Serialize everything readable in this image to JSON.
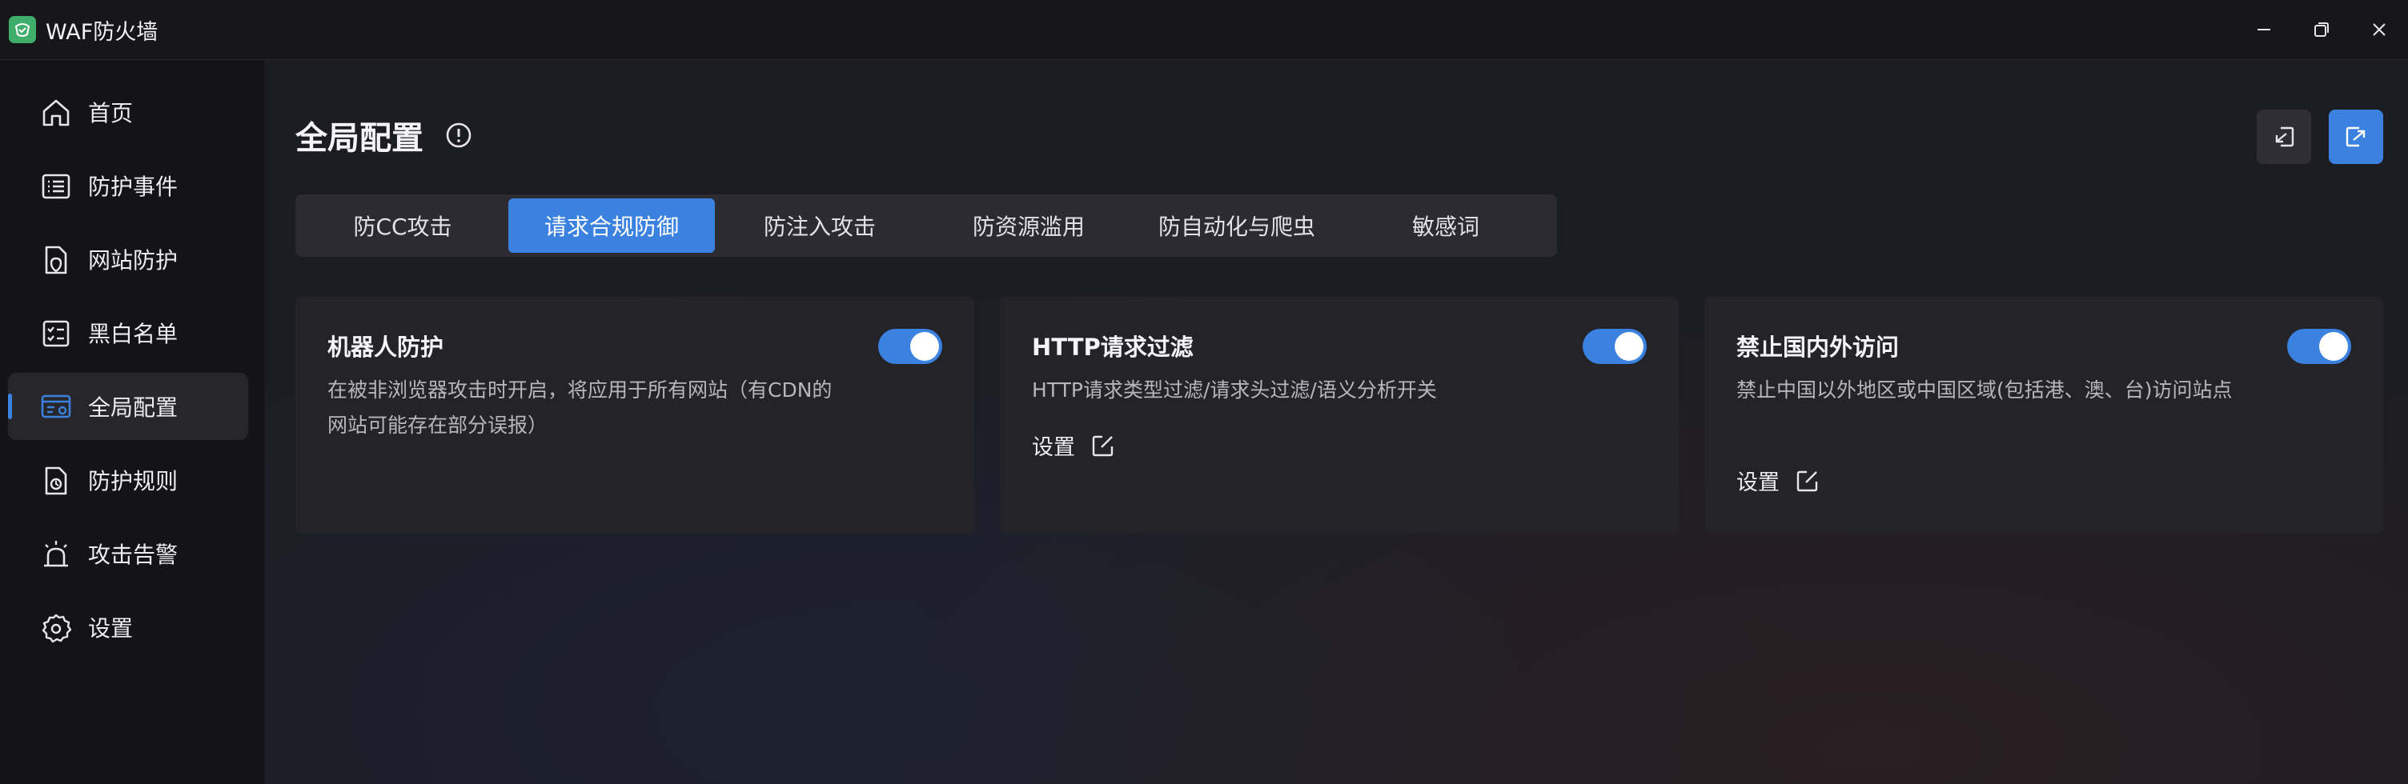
{
  "window": {
    "title": "WAF防火墙",
    "logo_text": "WAF"
  },
  "sidebar": {
    "items": [
      {
        "label": "首页",
        "icon": "home-icon"
      },
      {
        "label": "防护事件",
        "icon": "event-list-icon"
      },
      {
        "label": "网站防护",
        "icon": "site-shield-icon"
      },
      {
        "label": "黑白名单",
        "icon": "checklist-icon"
      },
      {
        "label": "全局配置",
        "icon": "global-config-icon",
        "active": true
      },
      {
        "label": "防护规则",
        "icon": "rule-file-icon"
      },
      {
        "label": "攻击告警",
        "icon": "alarm-icon"
      },
      {
        "label": "设置",
        "icon": "gear-icon"
      }
    ]
  },
  "main": {
    "title": "全局配置",
    "tabs": [
      {
        "label": "防CC攻击"
      },
      {
        "label": "请求合规防御",
        "active": true
      },
      {
        "label": "防注入攻击"
      },
      {
        "label": "防资源滥用"
      },
      {
        "label": "防自动化与爬虫"
      },
      {
        "label": "敏感词"
      }
    ],
    "cards": [
      {
        "title": "机器人防护",
        "desc": "在被非浏览器攻击时开启，将应用于所有网站（有CDN的网站可能存在部分误报）",
        "enabled": true
      },
      {
        "title": "HTTP请求过滤",
        "desc": "HTTP请求类型过滤/请求头过滤/语义分析开关",
        "enabled": true,
        "settings_label": "设置"
      },
      {
        "title": "禁止国内外访问",
        "desc": "禁止中国以外地区或中国区域(包括港、澳、台)访问站点",
        "enabled": true,
        "settings_label": "设置"
      }
    ]
  },
  "colors": {
    "accent": "#3b82e0",
    "sidebar_bg": "#141416",
    "card_bg": "#242428",
    "logo_green": "#3fae6a"
  }
}
